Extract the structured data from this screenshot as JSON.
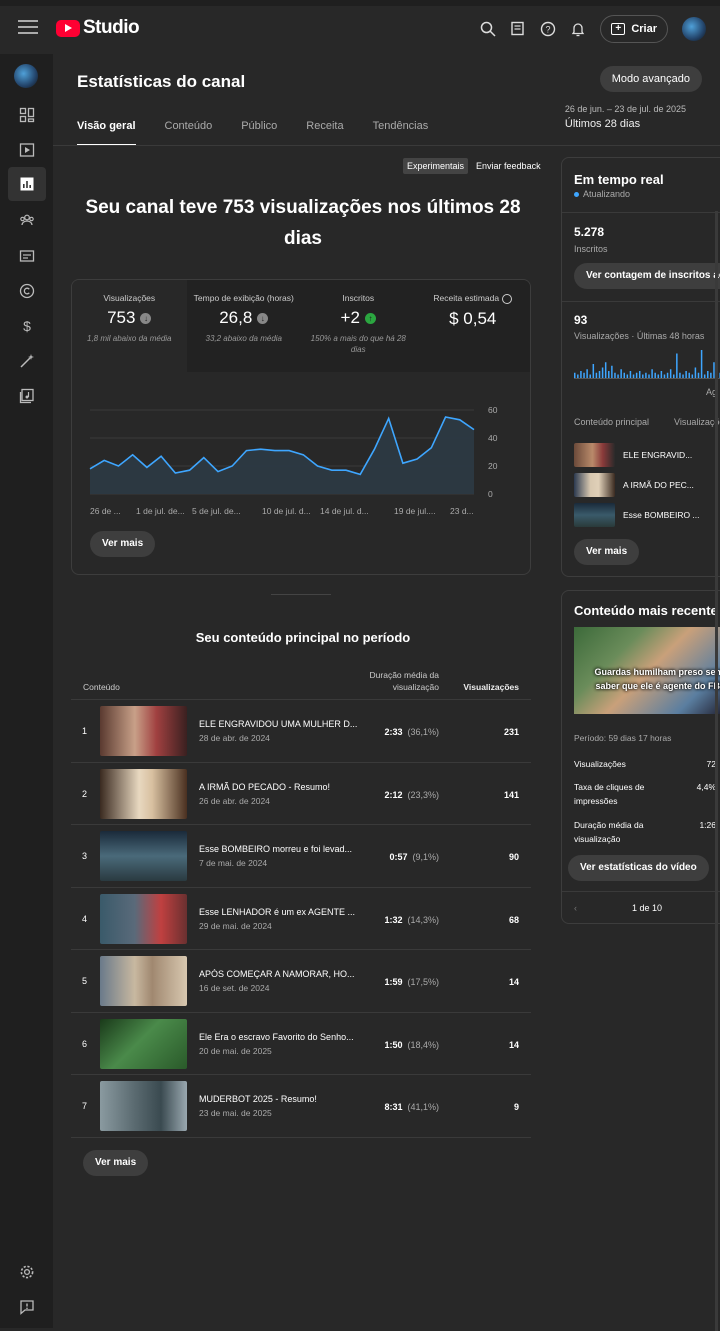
{
  "header": {
    "app_name": "Studio",
    "create_label": "Criar"
  },
  "page": {
    "title": "Estatísticas do canal",
    "advanced_mode": "Modo avançado",
    "date_range": "26 de jun. – 23 de jul. de 2025",
    "period_label": "Últimos 28 dias",
    "tabs": [
      "Visão geral",
      "Conteúdo",
      "Público",
      "Receita",
      "Tendências"
    ],
    "experiments_badge": "Experimentais",
    "feedback_link": "Enviar feedback",
    "headline": "Seu canal teve 753 visualizações nos últimos 28 dias"
  },
  "metrics": [
    {
      "label": "Visualizações",
      "value": "753",
      "comparison": "1,8 mil abaixo da média",
      "trend": "down"
    },
    {
      "label": "Tempo de exibição (horas)",
      "value": "26,8",
      "comparison": "33,2 abaixo da média",
      "trend": "down"
    },
    {
      "label": "Inscritos",
      "value": "+2",
      "comparison": "150% a mais do que há 28 dias",
      "trend": "up"
    },
    {
      "label": "Receita estimada",
      "value": "$ 0,54",
      "comparison": "",
      "trend": "none"
    }
  ],
  "chart_data": {
    "type": "area",
    "x_tick_labels": [
      "26 de ...",
      "1 de jul. de...",
      "5 de jul. de...",
      "10 de jul. d...",
      "14 de jul. d...",
      "19 de jul....",
      "23 d..."
    ],
    "y_ticks": [
      0,
      20,
      40,
      60
    ],
    "ylim": [
      0,
      60
    ],
    "series": [
      {
        "values": [
          18,
          24,
          20,
          28,
          19,
          27,
          15,
          17,
          26,
          16,
          20,
          31,
          32,
          31,
          31,
          28,
          20,
          17,
          17,
          14,
          32,
          54,
          22,
          25,
          33,
          55,
          53,
          46
        ]
      }
    ]
  },
  "ver_mais_label": "Ver mais",
  "top_content": {
    "title": "Seu conteúdo principal no período",
    "col_content": "Conteúdo",
    "col_duration": "Duração média da visualização",
    "col_views": "Visualizações",
    "rows": [
      {
        "rank": "1",
        "title": "ELE ENGRAVIDOU UMA MULHER D...",
        "date": "28 de abr. de 2024",
        "duration": "2:33",
        "pct": "(36,1%)",
        "views": "231"
      },
      {
        "rank": "2",
        "title": "A IRMÃ DO PECADO - Resumo!",
        "date": "26 de abr. de 2024",
        "duration": "2:12",
        "pct": "(23,3%)",
        "views": "141"
      },
      {
        "rank": "3",
        "title": "Esse BOMBEIRO morreu e foi levad...",
        "date": "7 de mai. de 2024",
        "duration": "0:57",
        "pct": "(9,1%)",
        "views": "90"
      },
      {
        "rank": "4",
        "title": "Esse LENHADOR é um ex AGENTE ...",
        "date": "29 de mai. de 2024",
        "duration": "1:32",
        "pct": "(14,3%)",
        "views": "68"
      },
      {
        "rank": "5",
        "title": "APÓS COMEÇAR A NAMORAR, HO...",
        "date": "16 de set. de 2024",
        "duration": "1:59",
        "pct": "(17,5%)",
        "views": "14"
      },
      {
        "rank": "6",
        "title": "Ele Era o escravo Favorito do Senho...",
        "date": "20 de mai. de 2025",
        "duration": "1:50",
        "pct": "(18,4%)",
        "views": "14"
      },
      {
        "rank": "7",
        "title": "MUDERBOT 2025 - Resumo!",
        "date": "23 de mai. de 2025",
        "duration": "8:31",
        "pct": "(41,1%)",
        "views": "9"
      }
    ]
  },
  "realtime": {
    "title": "Em tempo real",
    "status": "Atualizando",
    "subs_value": "5.278",
    "subs_label": "Inscritos",
    "subs_button": "Ver contagem de inscritos ao vivo",
    "views_value": "93",
    "views_label": "Visualizações · Últimas 48 horas",
    "axis_label": "Ag",
    "bars": [
      3,
      2,
      4,
      3,
      5,
      2,
      8,
      3,
      4,
      6,
      9,
      4,
      7,
      3,
      2,
      5,
      3,
      2,
      4,
      2,
      3,
      4,
      2,
      3,
      2,
      5,
      3,
      2,
      4,
      2,
      3,
      5,
      2,
      14,
      3,
      2,
      4,
      3,
      2,
      6,
      3,
      16,
      2,
      4,
      3,
      9,
      4,
      3,
      2
    ],
    "col_content": "Conteúdo principal",
    "col_views": "Visualizações",
    "items": [
      {
        "title": "ELE ENGRAVID..."
      },
      {
        "title": "A IRMÃ DO PEC..."
      },
      {
        "title": "Esse BOMBEIRO ..."
      }
    ]
  },
  "recent": {
    "title": "Conteúdo mais recente",
    "thumb_caption": "Guardas humilham preso sem saber que ele é agente do FBI",
    "period": "Período: 59 dias 17 horas",
    "stats": [
      {
        "label": "Visualizações",
        "value": "72"
      },
      {
        "label": "Taxa de cliques de impressões",
        "value": "4,4%"
      },
      {
        "label": "Duração média da visualização",
        "value": "1:26"
      }
    ],
    "button": "Ver estatísticas do vídeo",
    "pager": "1 de 10"
  },
  "colors": {
    "accent": "#3ea6ff",
    "brand": "#ff0033",
    "chart_line": "#3ea6ff",
    "up": "#2ba640"
  }
}
